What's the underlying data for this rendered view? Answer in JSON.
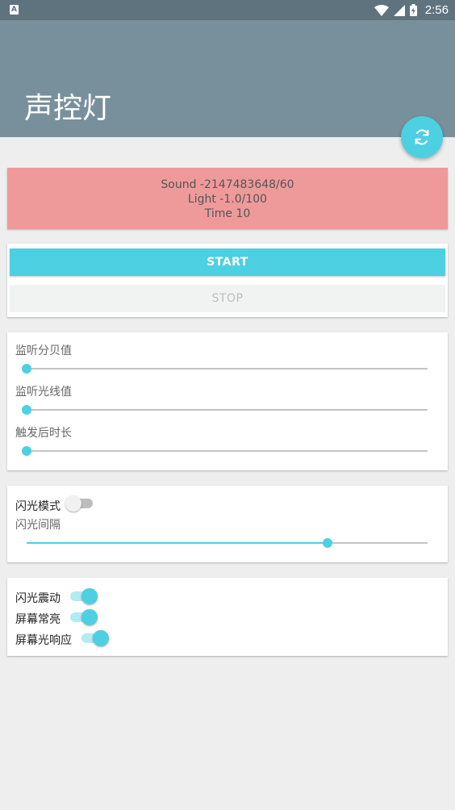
{
  "status_bar": {
    "clock": "2:56",
    "notification_icon": "A"
  },
  "app": {
    "title": "声控灯"
  },
  "fab": {
    "icon": "refresh-icon"
  },
  "info": {
    "sound": "Sound -2147483648/60",
    "light": "Light -1.0/100",
    "time": "Time 10"
  },
  "buttons": {
    "start": "START",
    "stop": "STOP"
  },
  "sliders": [
    {
      "label": "监听分贝值",
      "level": 0
    },
    {
      "label": "监听光线值",
      "level": 0
    },
    {
      "label": "触发后时长",
      "level": 0
    }
  ],
  "flash": {
    "mode_label": "闪光模式",
    "mode_on": false,
    "interval_label": "闪光间隔",
    "interval_level": 0.75
  },
  "toggles": [
    {
      "label": "闪光震动",
      "on": true
    },
    {
      "label": "屏幕常亮",
      "on": true
    },
    {
      "label": "屏幕光响应",
      "on": true
    }
  ],
  "colors": {
    "accent": "#4dd0e1",
    "app_bar": "#78909c",
    "status_bar": "#5f737f",
    "info_bg": "#ef9a9a"
  }
}
